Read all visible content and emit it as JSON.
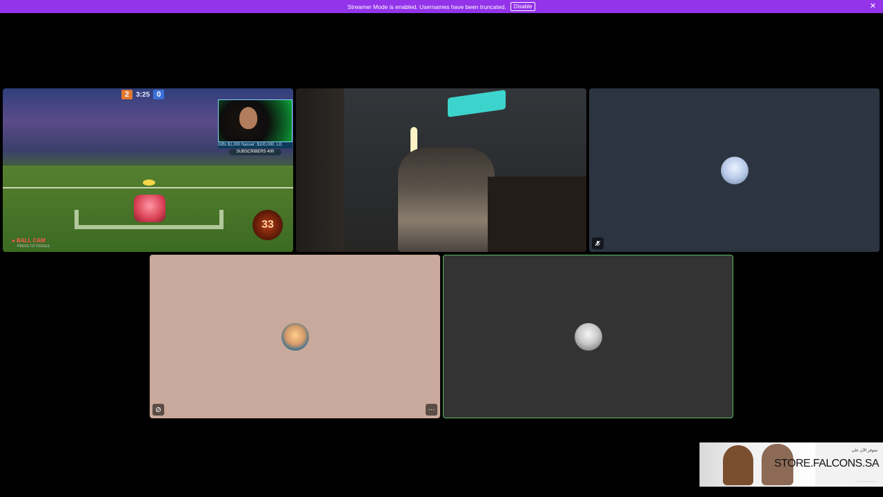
{
  "banner": {
    "message": "Streamer Mode is enabled. Usernames have been truncated.",
    "disable_label": "Disable",
    "close_glyph": "✕",
    "color": "#9333ea"
  },
  "game_tile": {
    "score_orange": "2",
    "timer": "3:25",
    "score_blue": "0",
    "ticker": "Gifts $1,000 Nasser: $100,000. LG",
    "subscribers": "SUBSCRIBERS 400",
    "ballcam": "● BALL CAM",
    "ballcam_hint": "PRESS TO TOGGLE",
    "boost": "33"
  },
  "tiles": {
    "blue_tile_icon": "mic-muted-icon",
    "pink_tile_left_icon": "screen-share-icon",
    "pink_tile_more": "···",
    "active_speaker_border": "#5dbb63"
  },
  "ad": {
    "arabic_line": "متوفر الآن على",
    "store": "STORE.FALCONS.SA",
    "dots": "— — — — —"
  }
}
